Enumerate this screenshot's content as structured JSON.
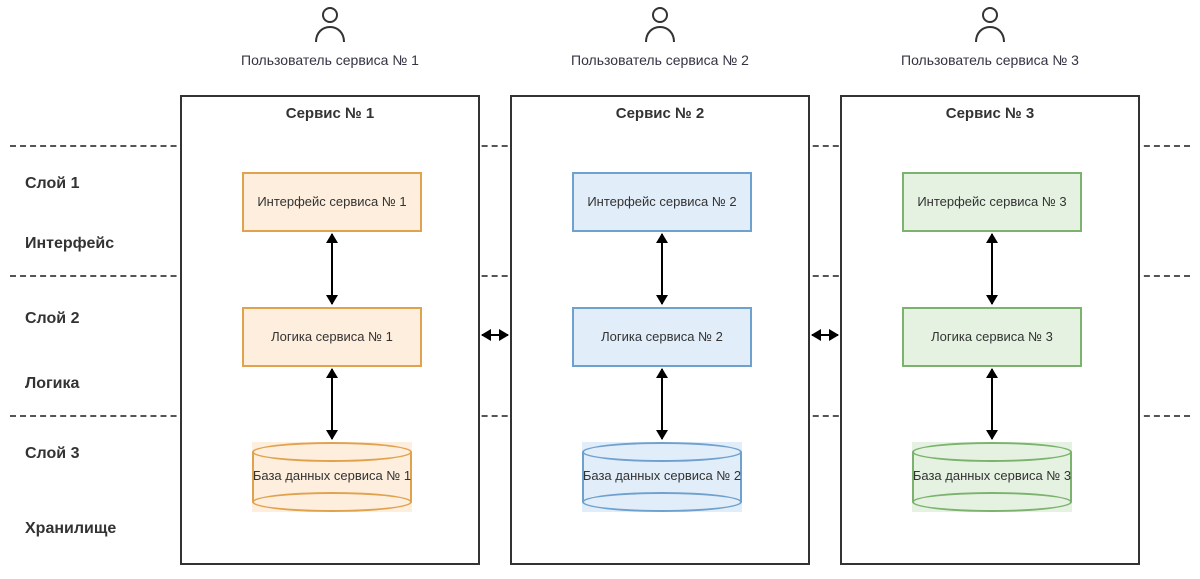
{
  "layers": {
    "l1a": "Слой 1",
    "l1b": "Интерфейс",
    "l2a": "Слой 2",
    "l2b": "Логика",
    "l3a": "Слой 3",
    "l3b": "Хранилище"
  },
  "services": [
    {
      "user_caption": "Пользователь сервиса № 1",
      "title": "Сервис № 1",
      "interface": "Интерфейс сервиса № 1",
      "logic": "Логика сервиса № 1",
      "db": "База данных сервиса № 1"
    },
    {
      "user_caption": "Пользователь сервиса № 2",
      "title": "Сервис № 2",
      "interface": "Интерфейс сервиса № 2",
      "logic": "Логика сервиса № 2",
      "db": "База данных сервиса № 2"
    },
    {
      "user_caption": "Пользователь сервиса № 3",
      "title": "Сервис № 3",
      "interface": "Интерфейс сервиса № 3",
      "logic": "Логика сервиса № 3",
      "db": "База данных сервиса № 3"
    }
  ]
}
